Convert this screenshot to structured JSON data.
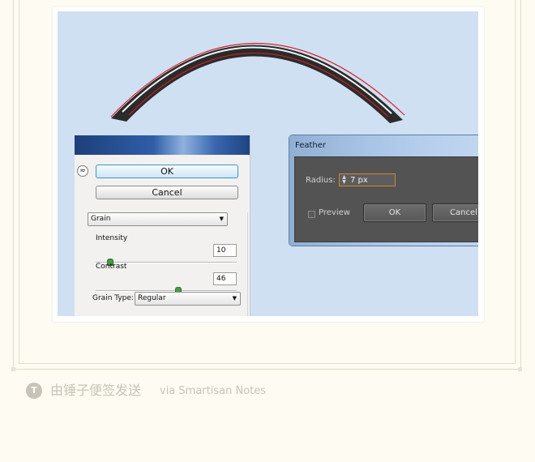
{
  "grain_panel": {
    "collapse_icon": "double-chevron-up-icon",
    "ok_label": "OK",
    "cancel_label": "Cancel",
    "filter_select": "Grain",
    "intensity_label": "Intensity",
    "intensity_value": "10",
    "contrast_label": "Contrast",
    "contrast_value": "46",
    "grain_type_label": "Grain Type:",
    "grain_type_value": "Regular",
    "intensity_slider": 10,
    "contrast_slider": 46
  },
  "feather_dialog": {
    "title": "Feather",
    "radius_label": "Radius:",
    "radius_value": "7 px",
    "preview_label": "Preview",
    "preview_checked": false,
    "ok_label": "OK",
    "cancel_label": "Cancel"
  },
  "footer": {
    "logo_letter": "T",
    "text": "由锤子便签发送",
    "sub": "via Smartisan Notes"
  },
  "colors": {
    "canvas_bg": "#cfe0f2",
    "arc_fill": "#2b2b2b",
    "arc_outline": "#d8222a",
    "page_bg": "#fdfbf2"
  }
}
